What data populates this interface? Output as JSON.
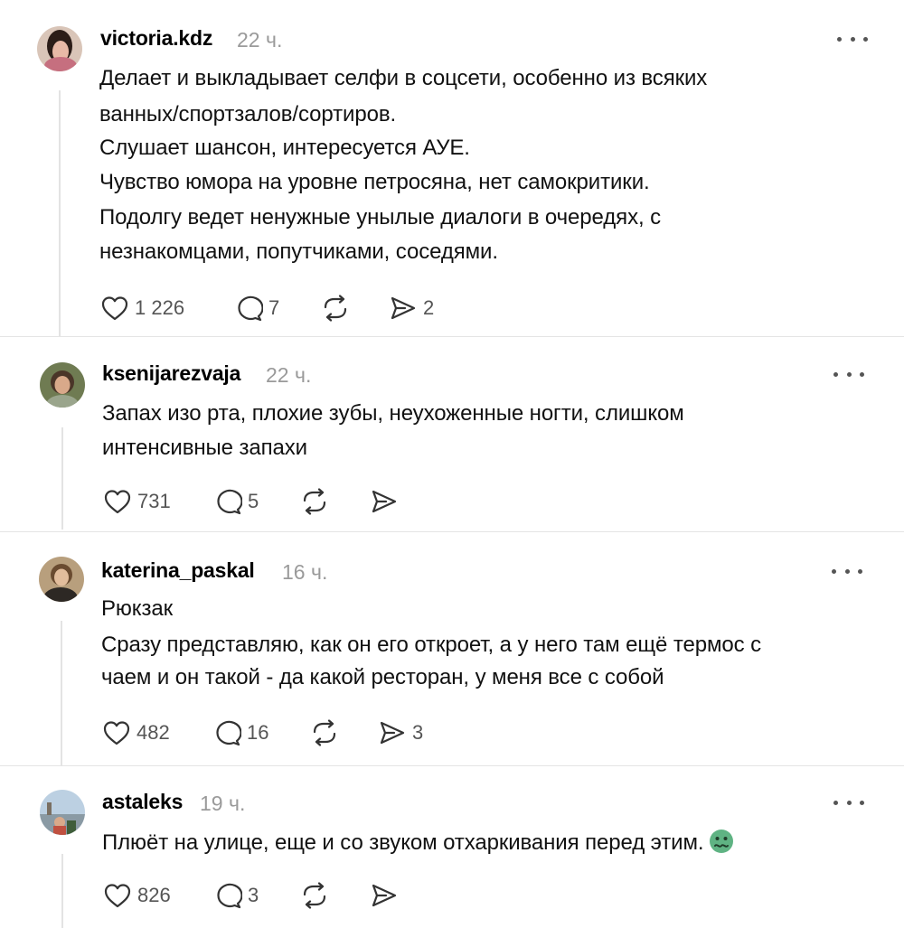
{
  "comments": [
    {
      "username": "victoria.kdz",
      "time": "22 ч.",
      "lines": [
        "Делает и выкладывает селфи в соцсети, особенно из всяких",
        "ванных/спортзалов/сортиров.",
        "Слушает шансон, интересуется АУЕ.",
        "Чувство юмора на уровне петросяна, нет самокритики.",
        "Подолгу ведет ненужные унылые диалоги в очередях, с",
        "незнакомцами, попутчиками, соседями."
      ],
      "likes": "1 226",
      "replies": "7",
      "shares": "2"
    },
    {
      "username": "ksenijarezvaja",
      "time": "22 ч.",
      "lines": [
        "Запах изо рта, плохие зубы, неухоженные ногти, слишком",
        "интенсивные запахи"
      ],
      "likes": "731",
      "replies": "5"
    },
    {
      "username": "katerina_paskal",
      "time": "16 ч.",
      "lines": [
        "Рюкзак",
        "Сразу представляю, как он его откроет, а у него там ещё термос с",
        "чаем и он такой - да какой ресторан, у меня все с собой"
      ],
      "likes": "482",
      "replies": "16",
      "shares": "3"
    },
    {
      "username": "astaleks",
      "time": "19 ч.",
      "lines": [
        "Плюёт на улице, еще и со звуком отхаркивания перед этим."
      ],
      "emoji": "nauseated-face-emoji",
      "likes": "826",
      "replies": "3"
    }
  ],
  "icons": {
    "like": "heart-icon",
    "reply": "comment-icon",
    "repost": "repost-icon",
    "share": "send-icon",
    "more": "more-icon"
  },
  "colors": {
    "text": "#111111",
    "meta": "#9a9a9a",
    "icon": "#333333",
    "emoji": "#5fb383"
  }
}
